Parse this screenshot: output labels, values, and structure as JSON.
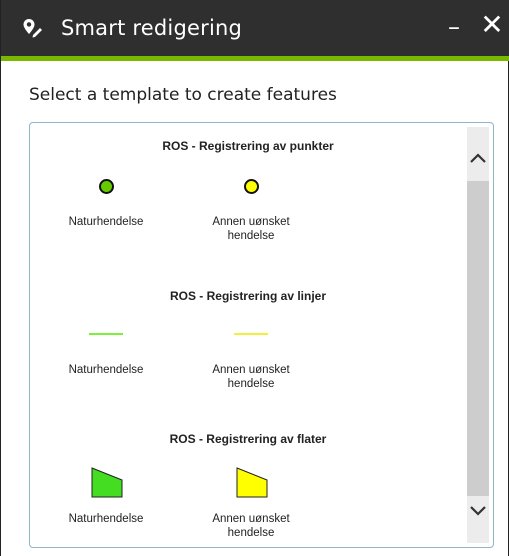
{
  "window": {
    "title": "Smart redigering",
    "minimize_icon": "minimize-icon",
    "close_icon": "close-icon",
    "title_icon": "smart-edit-icon",
    "accent_color": "#7ab800"
  },
  "instruction": "Select a template to create features",
  "groups": [
    {
      "title": "ROS - Registrering av punkter",
      "items": [
        {
          "label_line1": "Naturhendelse",
          "label_line2": "",
          "symbol": "point",
          "color": "#66cc00"
        },
        {
          "label_line1": "Annen uønsket",
          "label_line2": "hendelse",
          "symbol": "point",
          "color": "#ffff00"
        }
      ]
    },
    {
      "title": "ROS - Registrering av linjer",
      "items": [
        {
          "label_line1": "Naturhendelse",
          "label_line2": "",
          "symbol": "line",
          "color": "#7cf03a"
        },
        {
          "label_line1": "Annen uønsket",
          "label_line2": "hendelse",
          "symbol": "line",
          "color": "#f2f03a"
        }
      ]
    },
    {
      "title": "ROS - Registrering av flater",
      "items": [
        {
          "label_line1": "Naturhendelse",
          "label_line2": "",
          "symbol": "polygon",
          "color": "#44dd22"
        },
        {
          "label_line1": "Annen uønsket",
          "label_line2": "hendelse",
          "symbol": "polygon",
          "color": "#ffff00"
        }
      ]
    }
  ],
  "scrollbar": {
    "up_icon": "chevron-up-icon",
    "down_icon": "chevron-down-icon"
  }
}
